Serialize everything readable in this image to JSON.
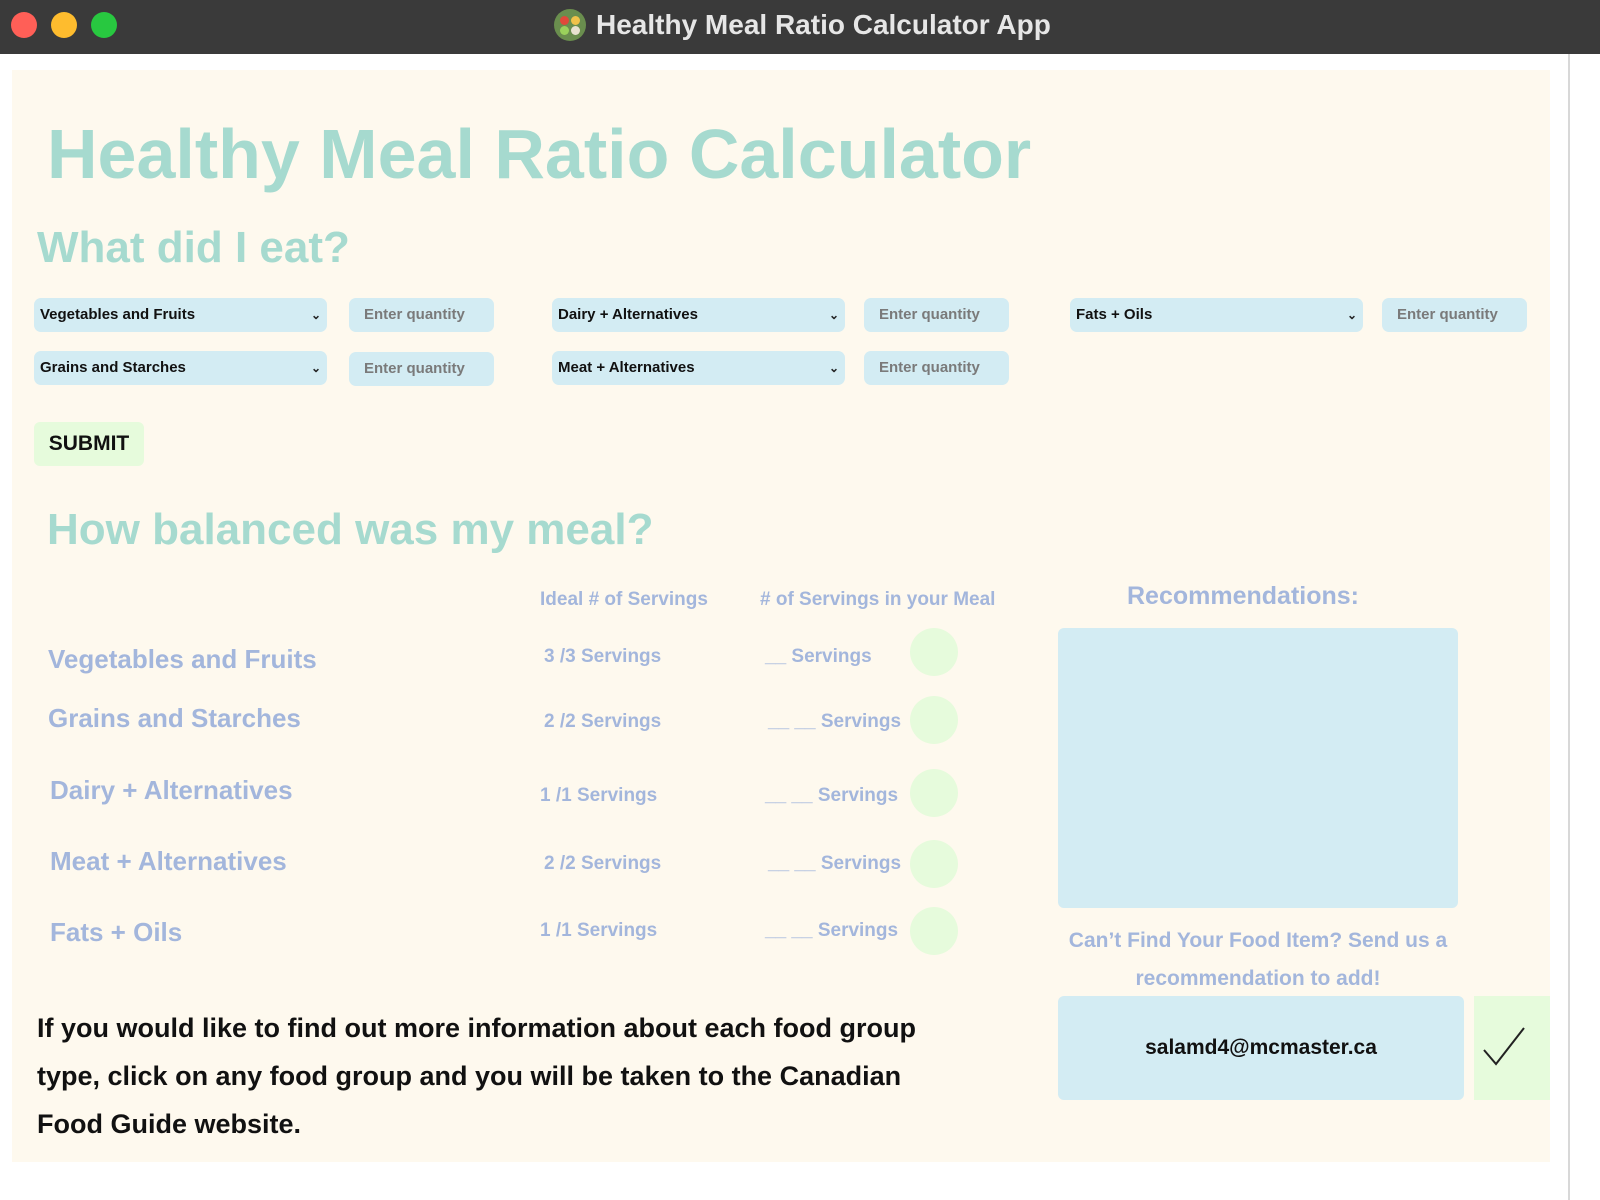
{
  "window": {
    "title": "Healthy Meal Ratio Calculator App"
  },
  "header": {
    "title": "Healthy Meal Ratio Calculator",
    "section_input": "What did I eat?",
    "section_results": "How balanced was my meal?"
  },
  "inputs": {
    "placeholder": "Enter quantity",
    "groups": [
      {
        "selected": "Vegetables and Fruits"
      },
      {
        "selected": "Dairy + Alternatives"
      },
      {
        "selected": "Fats + Oils"
      },
      {
        "selected": "Grains and Starches"
      },
      {
        "selected": "Meat + Alternatives"
      }
    ],
    "submit_label": "SUBMIT"
  },
  "results": {
    "col_ideal": "Ideal # of Servings",
    "col_meal": "# of Servings in your Meal",
    "rows": [
      {
        "group": "Vegetables and Fruits",
        "ideal": "3 /3 Servings",
        "meal": "__ Servings"
      },
      {
        "group": "Grains and Starches",
        "ideal": "2 /2 Servings",
        "meal": "__ __ Servings"
      },
      {
        "group": "Dairy + Alternatives",
        "ideal": "1 /1 Servings",
        "meal": "__ __ Servings"
      },
      {
        "group": "Meat + Alternatives",
        "ideal": "2 /2 Servings",
        "meal": "__ __ Servings"
      },
      {
        "group": "Fats + Oils",
        "ideal": "1 /1 Servings",
        "meal": "__ __ Servings"
      }
    ]
  },
  "recommendations": {
    "title": "Recommendations:",
    "body": ""
  },
  "suggest": {
    "prompt": "Can’t Find Your Food Item? Send us a recommendation to add!",
    "email": "salamd4@mcmaster.ca"
  },
  "info_text": "If you would like to find out more information about each food group type, click on any food group and you will be taken to the Canadian Food Guide website.",
  "colors": {
    "heading": "#a6dacf",
    "label": "#a3b6dc",
    "field_bg": "#d3ecf3",
    "button_bg": "#e6fbdc",
    "panel_bg": "#fef9ee",
    "titlebar": "#3a3a3a"
  }
}
